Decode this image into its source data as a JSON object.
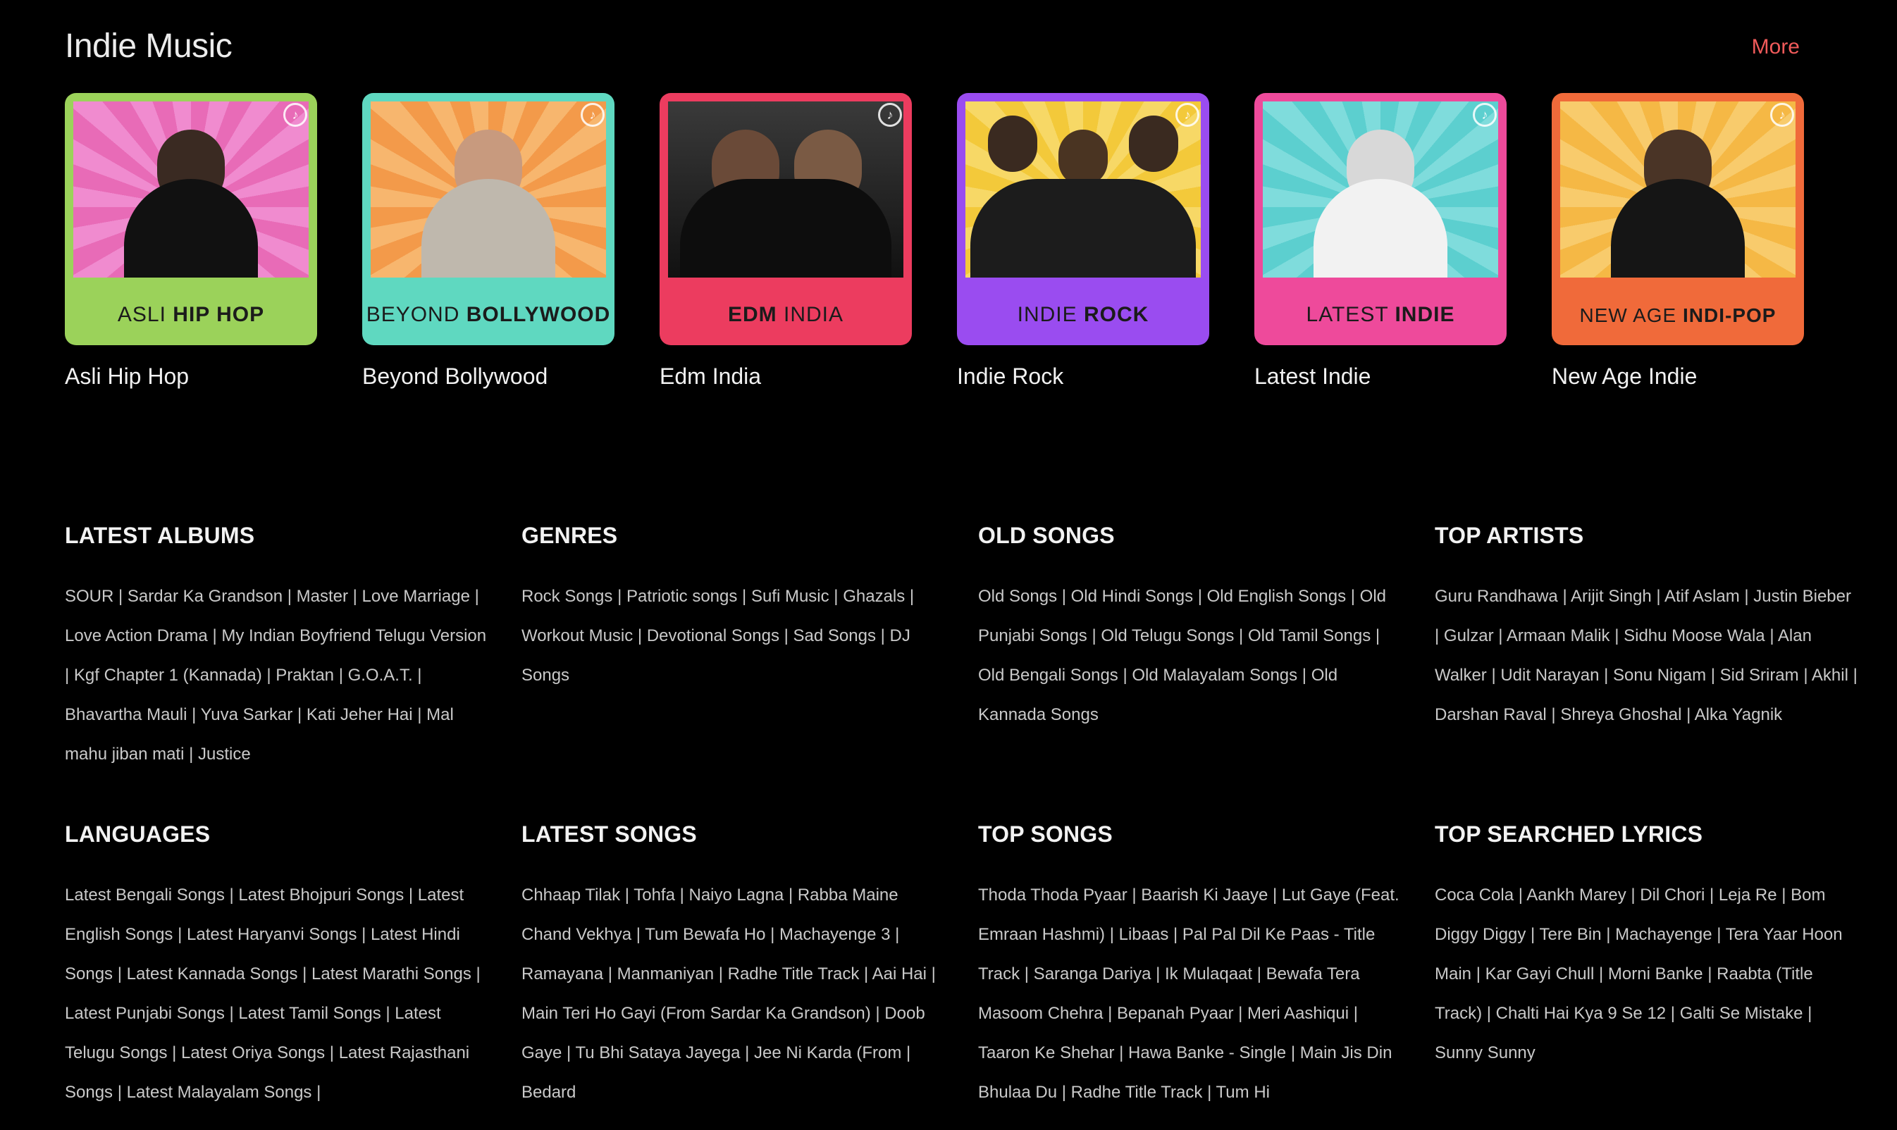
{
  "section": {
    "title": "Indie Music",
    "more_label": "More"
  },
  "playlists": [
    {
      "title": "Asli Hip Hop",
      "cover_light": "ASLI",
      "cover_bold": "HIP HOP",
      "bg": "#9bd25a",
      "art_bg": "#e86bb7",
      "icon": "music-note-icon"
    },
    {
      "title": "Beyond Bollywood",
      "cover_light": "BEYOND",
      "cover_bold": "BOLLYWOOD",
      "bg": "#5fd8c0",
      "art_bg": "#f39a4a",
      "icon": "music-note-icon"
    },
    {
      "title": "Edm India",
      "cover_light": "INDIA",
      "cover_bold": "EDM",
      "bg": "#ec3c5f",
      "art_bg": "#2a2a2a",
      "icon": "music-note-icon"
    },
    {
      "title": "Indie Rock",
      "cover_light": "INDIE",
      "cover_bold": "ROCK",
      "bg": "#9a4cf0",
      "art_bg": "#f3c93a",
      "icon": "music-note-icon"
    },
    {
      "title": "Latest Indie",
      "cover_light": "LATEST",
      "cover_bold": "INDIE",
      "bg": "#ee4a9b",
      "art_bg": "#5ccfcf",
      "icon": "music-note-icon"
    },
    {
      "title": "New Age Indie",
      "cover_light": "NEW AGE",
      "cover_bold": "INDI-POP",
      "bg": "#f06a3a",
      "art_bg": "#f5b845",
      "icon": "music-note-icon"
    }
  ],
  "footer_columns": [
    {
      "heading": "LATEST ALBUMS",
      "text": "SOUR | Sardar Ka Grandson | Master | Love Marriage | Love Action Drama | My Indian Boyfriend Telugu Version | Kgf Chapter 1 (Kannada) | Praktan | G.O.A.T. | Bhavartha Mauli | Yuva Sarkar | Kati Jeher Hai | Mal mahu jiban mati | Justice"
    },
    {
      "heading": "GENRES",
      "text": "Rock Songs | Patriotic songs | Sufi Music | Ghazals | Workout Music | Devotional Songs | Sad Songs | DJ Songs"
    },
    {
      "heading": "OLD SONGS",
      "text": "Old Songs | Old Hindi Songs | Old English Songs | Old Punjabi Songs | Old Telugu Songs | Old Tamil Songs | Old Bengali Songs | Old Malayalam Songs | Old Kannada Songs"
    },
    {
      "heading": "TOP ARTISTS",
      "text": "Guru Randhawa | Arijit Singh | Atif Aslam | Justin Bieber | Gulzar | Armaan Malik | Sidhu Moose Wala | Alan Walker | Udit Narayan | Sonu Nigam | Sid Sriram | Akhil | Darshan Raval | Shreya Ghoshal | Alka Yagnik"
    },
    {
      "heading": "LANGUAGES",
      "text": "Latest Bengali Songs | Latest Bhojpuri Songs | Latest English Songs | Latest Haryanvi Songs | Latest Hindi Songs | Latest Kannada Songs | Latest Marathi Songs | Latest Punjabi Songs | Latest Tamil Songs | Latest Telugu Songs | Latest Oriya Songs | Latest Rajasthani Songs | Latest Malayalam Songs |"
    },
    {
      "heading": "LATEST SONGS",
      "text": "Chhaap Tilak | Tohfa | Naiyo Lagna | Rabba Maine Chand Vekhya | Tum Bewafa Ho | Machayenge 3 | Ramayana | Manmaniyan | Radhe Title Track | Aai Hai | Main Teri Ho Gayi (From Sardar Ka Grandson) | Doob Gaye | Tu Bhi Sataya Jayega | Jee Ni Karda (From | Bedard"
    },
    {
      "heading": "TOP SONGS",
      "text": "Thoda Thoda Pyaar | Baarish Ki Jaaye | Lut Gaye (Feat. Emraan Hashmi) | Libaas | Pal Pal Dil Ke Paas - Title Track | Saranga Dariya | Ik Mulaqaat | Bewafa Tera Masoom Chehra | Bepanah Pyaar | Meri Aashiqui | Taaron Ke Shehar | Hawa Banke - Single | Main Jis Din Bhulaa Du | Radhe Title Track | Tum Hi"
    },
    {
      "heading": "TOP SEARCHED LYRICS",
      "text": "Coca Cola | Aankh Marey | Dil Chori | Leja Re | Bom Diggy Diggy | Tere Bin | Machayenge | Tera Yaar Hoon Main | Kar Gayi Chull | Morni Banke | Raabta (Title Track) | Chalti Hai Kya 9 Se 12 | Galti Se Mistake | Sunny Sunny"
    }
  ]
}
